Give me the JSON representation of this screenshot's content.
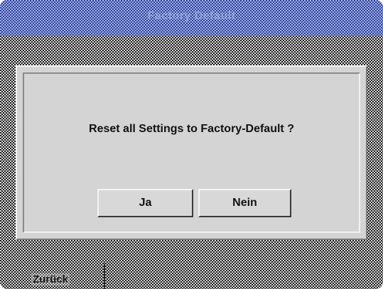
{
  "window": {
    "title": "Factory Default"
  },
  "dialog": {
    "message": "Reset all Settings to Factory-Default ?",
    "yes_label": "Ja",
    "no_label": "Nein"
  },
  "footer": {
    "back_label": "Zurück"
  },
  "colors": {
    "title_bar": "#3a4fa8",
    "dialog_bg": "#d4d4d4",
    "pattern_dark": "#1e1e1e",
    "pattern_light": "#d8d8d8"
  }
}
